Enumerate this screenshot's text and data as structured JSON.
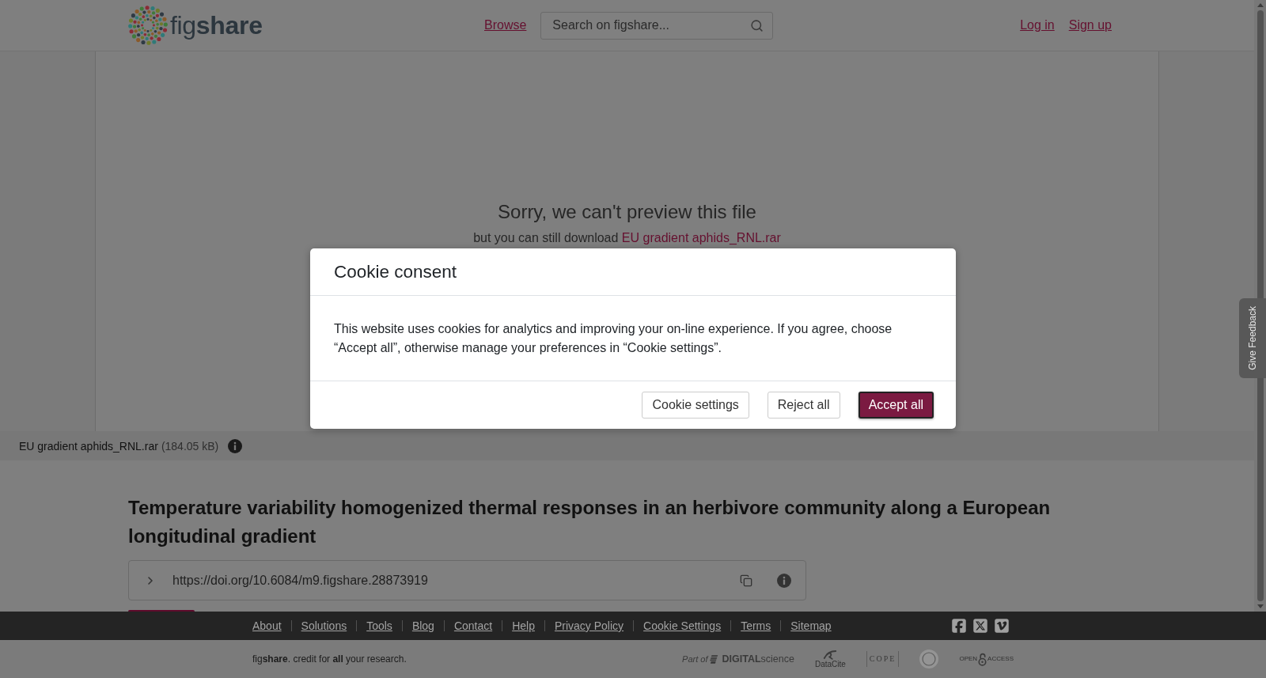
{
  "header": {
    "logo": {
      "wordmark": "fig**share**"
    },
    "nav": [
      {
        "label": "Browse"
      }
    ],
    "search": {
      "placeholder": "Search on figshare..."
    },
    "auth_links": [
      {
        "label": "Log in"
      },
      {
        "label": "Sign up"
      }
    ]
  },
  "preview": {
    "message": "Sorry, we can't preview this file",
    "download_prefix": "but you can still download",
    "download_link": "EU gradient aphids_RNL.rar"
  },
  "file_bar": {
    "file_name": "EU gradient aphids_RNL.rar",
    "file_size": "(184.05 kB)"
  },
  "item": {
    "title": "Temperature variability homogenized thermal responses in an herbivore community along a European longitudinal gradient",
    "doi": "https://doi.org/10.6084/m9.figshare.28873919"
  },
  "feedback_tab": {
    "label": "Give Feedback"
  },
  "cookie_modal": {
    "title": "Cookie consent",
    "body": "This website uses cookies for analytics and improving your on-line experience. If you agree, choose “Accept all”, otherwise manage your preferences in “Cookie settings”.",
    "buttons": [
      {
        "label": "Cookie settings",
        "kind": "secondary",
        "focused": false
      },
      {
        "label": "Reject all",
        "kind": "secondary",
        "focused": false
      },
      {
        "label": "Accept all",
        "kind": "primary",
        "focused": true
      }
    ]
  },
  "footer": {
    "links": [
      {
        "label": "About"
      },
      {
        "label": "Solutions"
      },
      {
        "label": "Tools"
      },
      {
        "label": "Blog"
      },
      {
        "label": "Contact"
      },
      {
        "label": "Help"
      },
      {
        "label": "Privacy Policy"
      },
      {
        "label": "Cookie Settings"
      },
      {
        "label": "Terms"
      },
      {
        "label": "Sitemap"
      }
    ],
    "tagline": "fig**share**. credit for **all** your research.",
    "partners": [
      {
        "kind": "digital_science",
        "caption": "Part of",
        "wordmark": "**DIGITAL**science"
      },
      {
        "kind": "datacite",
        "wordmark": "DataCite"
      },
      {
        "kind": "cope",
        "wordmark": "COPE"
      },
      {
        "kind": "seal"
      },
      {
        "kind": "open_access",
        "words": [
          "OPEN",
          "ACCESS"
        ]
      }
    ]
  }
}
